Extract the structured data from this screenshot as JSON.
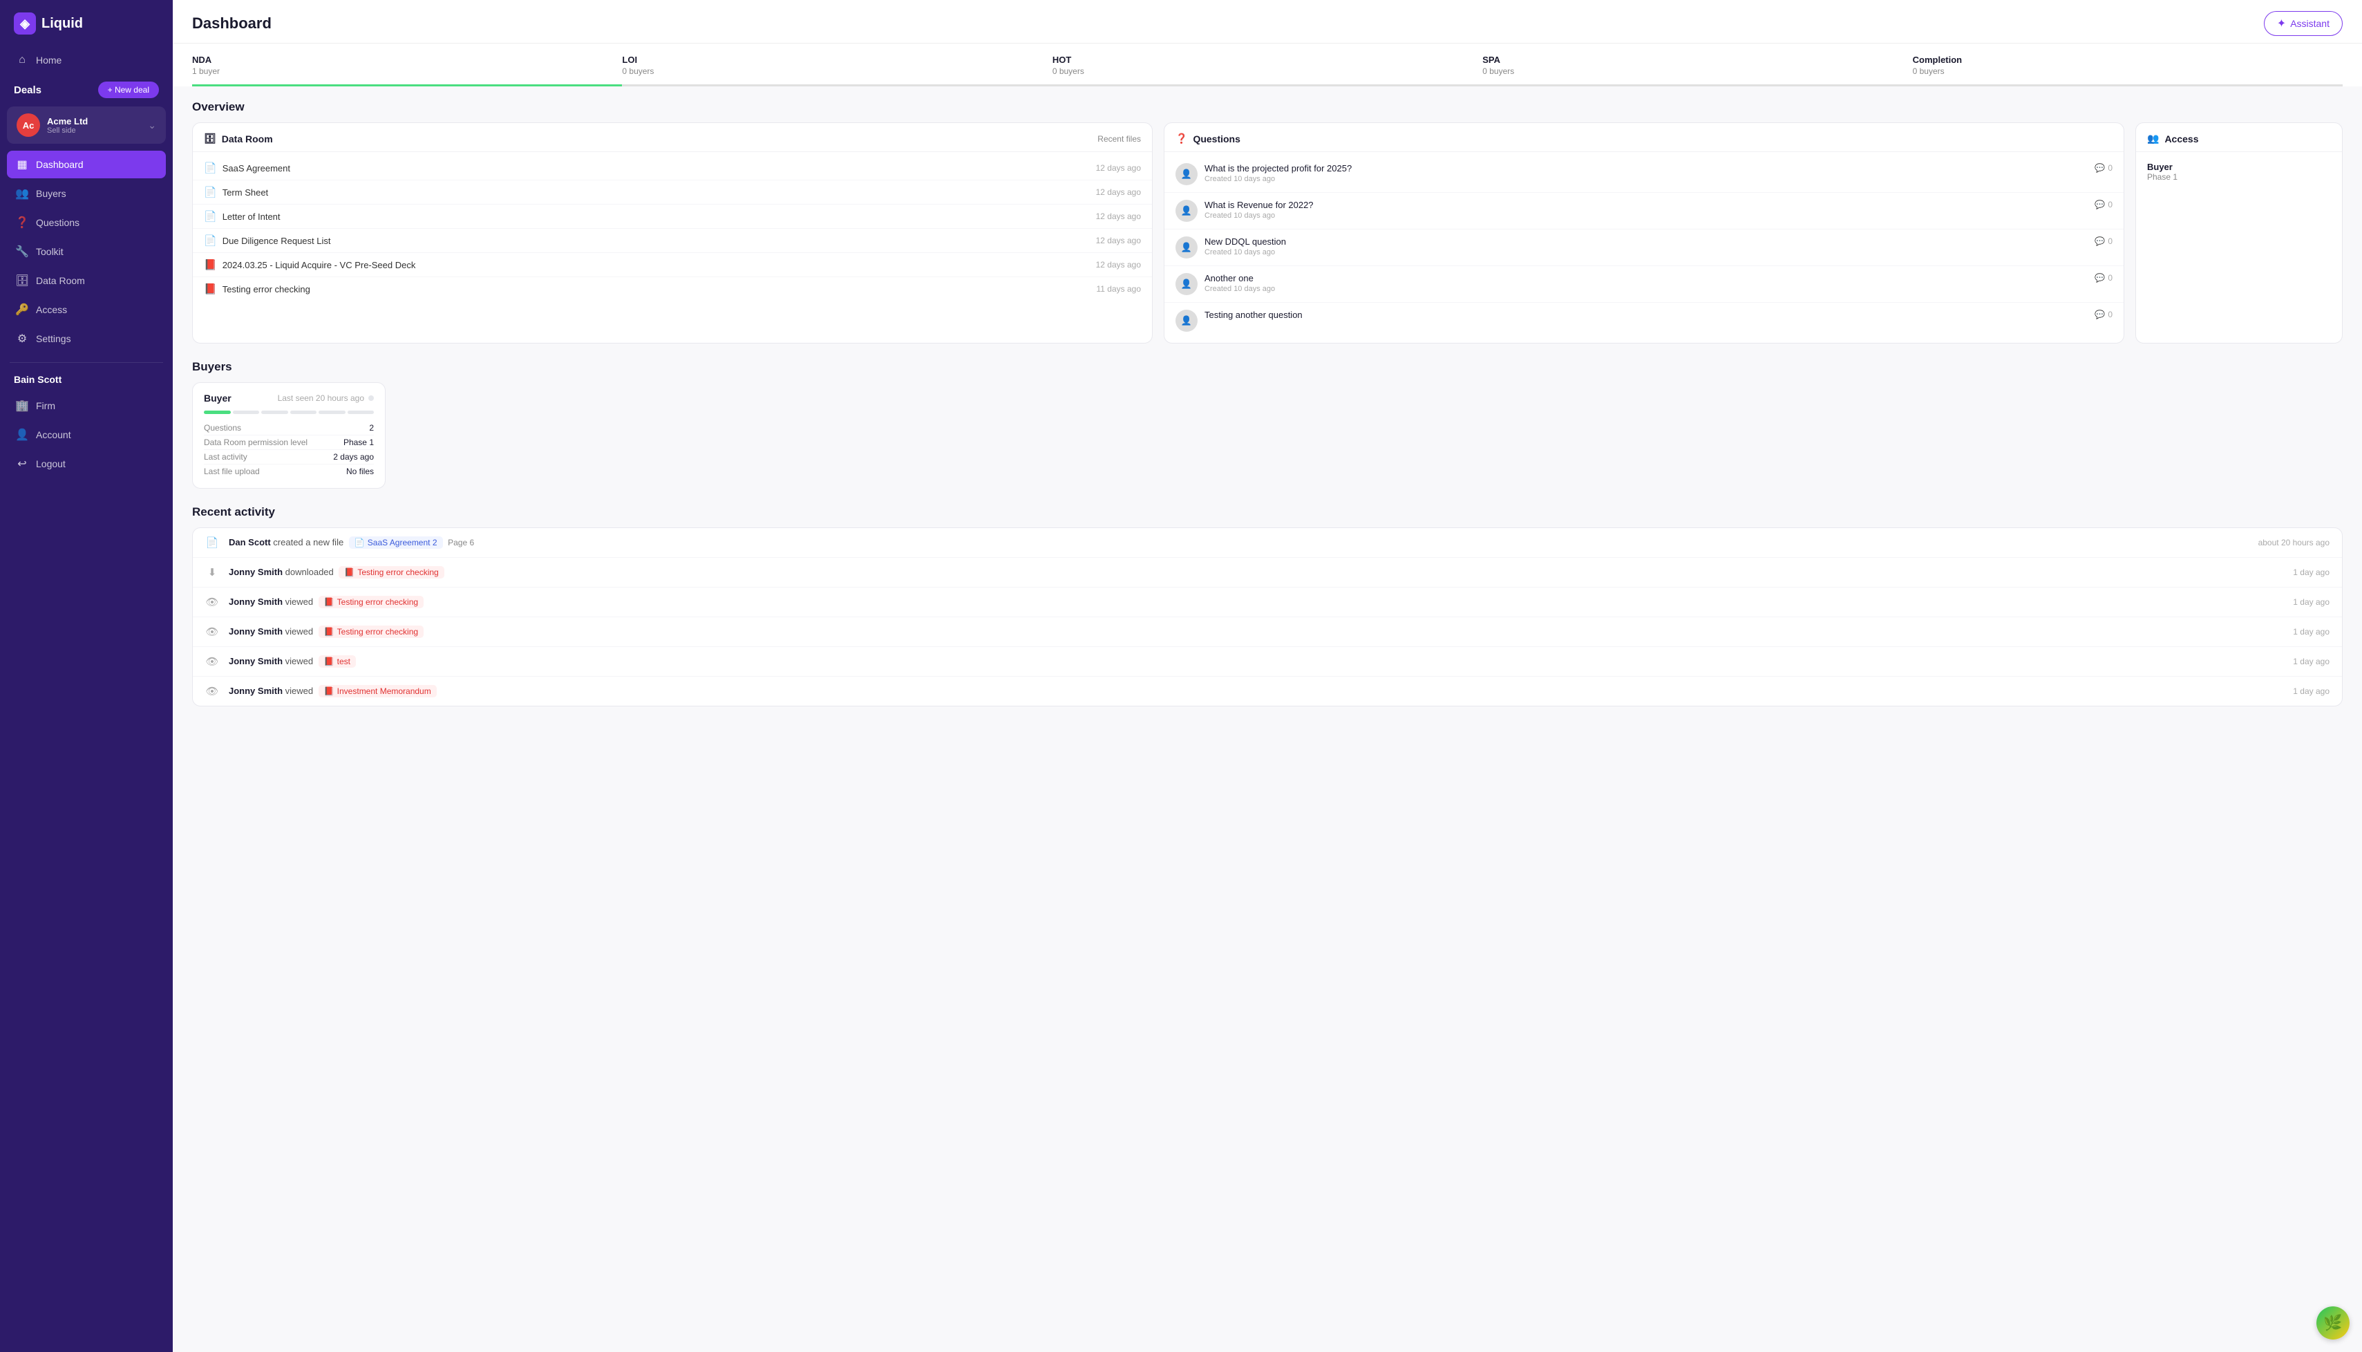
{
  "app": {
    "logo_text": "Liquid",
    "logo_symbol": "◈"
  },
  "sidebar": {
    "top_nav": [
      {
        "id": "home",
        "label": "Home",
        "icon": "⌂"
      }
    ],
    "deals_label": "Deals",
    "new_deal_label": "+ New deal",
    "deal": {
      "initials": "Ac",
      "name": "Acme Ltd",
      "sub": "Sell side"
    },
    "deal_nav": [
      {
        "id": "dashboard",
        "label": "Dashboard",
        "icon": "▦",
        "active": true
      },
      {
        "id": "buyers",
        "label": "Buyers",
        "icon": "👥"
      },
      {
        "id": "questions",
        "label": "Questions",
        "icon": "❓"
      },
      {
        "id": "toolkit",
        "label": "Toolkit",
        "icon": "🔧"
      },
      {
        "id": "data-room",
        "label": "Data Room",
        "icon": "🗄"
      },
      {
        "id": "access",
        "label": "Access",
        "icon": "🔑"
      },
      {
        "id": "settings",
        "label": "Settings",
        "icon": "⚙"
      }
    ],
    "user_name": "Bain Scott",
    "user_nav": [
      {
        "id": "firm",
        "label": "Firm",
        "icon": "🏢"
      },
      {
        "id": "account",
        "label": "Account",
        "icon": "👤"
      },
      {
        "id": "logout",
        "label": "Logout",
        "icon": "↩"
      }
    ]
  },
  "header": {
    "title": "Dashboard",
    "assistant_label": "Assistant"
  },
  "pipeline": {
    "stages": [
      {
        "id": "nda",
        "label": "NDA",
        "count": "1 buyer",
        "active": true
      },
      {
        "id": "loi",
        "label": "LOI",
        "count": "0 buyers",
        "active": false
      },
      {
        "id": "hot",
        "label": "HOT",
        "count": "0 buyers",
        "active": false
      },
      {
        "id": "spa",
        "label": "SPA",
        "count": "0 buyers",
        "active": false
      },
      {
        "id": "completion",
        "label": "Completion",
        "count": "0 buyers",
        "active": false
      }
    ]
  },
  "overview": {
    "title": "Overview",
    "data_room": {
      "title": "Data Room",
      "header_action": "Recent files",
      "files": [
        {
          "name": "SaaS Agreement",
          "time": "12 days ago",
          "type": "blue"
        },
        {
          "name": "Term Sheet",
          "time": "12 days ago",
          "type": "blue"
        },
        {
          "name": "Letter of Intent",
          "time": "12 days ago",
          "type": "blue"
        },
        {
          "name": "Due Diligence Request List",
          "time": "12 days ago",
          "type": "blue"
        },
        {
          "name": "2024.03.25 - Liquid Acquire - VC Pre-Seed Deck",
          "time": "12 days ago",
          "type": "red"
        },
        {
          "name": "Testing error checking",
          "time": "11 days ago",
          "type": "red"
        }
      ]
    },
    "questions": {
      "title": "Questions",
      "items": [
        {
          "question": "What is the projected profit for 2025?",
          "sub": "Created 10 days ago",
          "comments": 0
        },
        {
          "question": "What is Revenue for 2022?",
          "sub": "Created 10 days ago",
          "comments": 0
        },
        {
          "question": "New DDQL question",
          "sub": "Created 10 days ago",
          "comments": 0
        },
        {
          "question": "Another one",
          "sub": "Created 10 days ago",
          "comments": 0
        },
        {
          "question": "Testing another question",
          "sub": "",
          "comments": 0
        }
      ]
    },
    "access": {
      "title": "Access",
      "buyer": "Buyer",
      "phase": "Phase 1"
    }
  },
  "buyers": {
    "title": "Buyers",
    "buyer_card": {
      "name": "Buyer",
      "last_seen": "Last seen 20 hours ago",
      "progress_segments": [
        {
          "filled": true
        },
        {
          "filled": false
        },
        {
          "filled": false
        },
        {
          "filled": false
        },
        {
          "filled": false
        },
        {
          "filled": false
        }
      ],
      "stats": [
        {
          "label": "Questions",
          "value": "2"
        },
        {
          "label": "Data Room permission level",
          "value": "Phase 1"
        },
        {
          "label": "Last activity",
          "value": "2 days ago"
        },
        {
          "label": "Last file upload",
          "value": "No files"
        }
      ]
    }
  },
  "recent_activity": {
    "title": "Recent activity",
    "items": [
      {
        "icon": "doc",
        "user": "Dan Scott",
        "action": "created a new file",
        "file": "SaaS Agreement 2",
        "file_type": "blue",
        "extra": "Page 6",
        "time": "about 20 hours ago"
      },
      {
        "icon": "download",
        "user": "Jonny Smith",
        "action": "downloaded",
        "file": "Testing error checking",
        "file_type": "red",
        "extra": "",
        "time": "1 day ago"
      },
      {
        "icon": "eye",
        "user": "Jonny Smith",
        "action": "viewed",
        "file": "Testing error checking",
        "file_type": "red",
        "extra": "",
        "time": "1 day ago"
      },
      {
        "icon": "eye",
        "user": "Jonny Smith",
        "action": "viewed",
        "file": "Testing error checking",
        "file_type": "red",
        "extra": "",
        "time": "1 day ago"
      },
      {
        "icon": "eye",
        "user": "Jonny Smith",
        "action": "viewed",
        "file": "test",
        "file_type": "red",
        "extra": "",
        "time": "1 day ago"
      },
      {
        "icon": "eye",
        "user": "Jonny Smith",
        "action": "viewed",
        "file": "Investment Memorandum",
        "file_type": "red",
        "extra": "",
        "time": "1 day ago"
      }
    ]
  }
}
